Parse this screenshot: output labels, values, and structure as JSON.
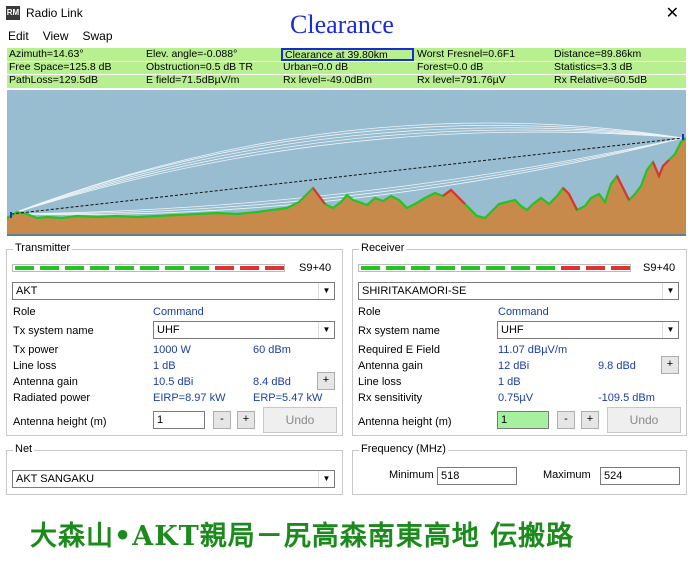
{
  "window": {
    "title": "Radio Link",
    "overlay_title": "Clearance",
    "icon_text": "RM"
  },
  "menu": [
    "Edit",
    "View",
    "Swap"
  ],
  "stats": {
    "row1": [
      "Azimuth=14.63°",
      "Elev. angle=-0.088°",
      "Clearance at 39.80km",
      "Worst Fresnel=0.6F1",
      "Distance=89.86km"
    ],
    "row2": [
      "Free Space=125.8 dB",
      "Obstruction=0.5 dB TR",
      "Urban=0.0 dB",
      "Forest=0.0 dB",
      "Statistics=3.3 dB"
    ],
    "row3": [
      "PathLoss=129.5dB",
      "E field=71.5dBµV/m",
      "Rx level=-49.0dBm",
      "Rx level=791.76µV",
      "Rx Relative=60.5dB"
    ]
  },
  "colors": {
    "accent": "#1a2bd8",
    "stats_bg": "#b8f090",
    "sky": "#98bcd0",
    "terrain": "#c88a4a",
    "banner": "#1d8a1d",
    "meter_green": "#22c422",
    "meter_red": "#e03030"
  },
  "transmitter": {
    "caption": "Transmitter",
    "signal": "S9+40",
    "station": "AKT",
    "role_label": "Role",
    "role_value": "Command",
    "system_label": "Tx system name",
    "system_value": "UHF",
    "power_label": "Tx power",
    "power_w": "1000 W",
    "power_dbm": "60 dBm",
    "line_loss_label": "Line loss",
    "line_loss": "1 dB",
    "gain_label": "Antenna gain",
    "gain_dbi": "10.5 dBi",
    "gain_dbd": "8.4 dBd",
    "radiated_label": "Radiated power",
    "eirp": "EIRP=8.97 kW",
    "erp": "ERP=5.47 kW",
    "height_label": "Antenna height (m)",
    "height_value": "1",
    "undo": "Undo",
    "minus": "-",
    "plus": "+"
  },
  "receiver": {
    "caption": "Receiver",
    "signal": "S9+40",
    "station": "SHIRITAKAMORI-SE",
    "role_label": "Role",
    "role_value": "Command",
    "system_label": "Rx system name",
    "system_value": "UHF",
    "field_label": "Required E Field",
    "field_value": "11.07 dBµV/m",
    "gain_label": "Antenna gain",
    "gain_dbi": "12 dBi",
    "gain_dbd": "9.8 dBd",
    "line_loss_label": "Line loss",
    "line_loss": "1 dB",
    "sens_label": "Rx sensitivity",
    "sens_uv": "0.75µV",
    "sens_dbm": "-109.5 dBm",
    "height_label": "Antenna height (m)",
    "height_value": "1",
    "undo": "Undo",
    "minus": "-",
    "plus": "+"
  },
  "net": {
    "caption": "Net",
    "value": "AKT SANGAKU"
  },
  "frequency": {
    "caption": "Frequency (MHz)",
    "min_label": "Minimum",
    "min_value": "518",
    "max_label": "Maximum",
    "max_value": "524"
  },
  "banner": "大森山•AKT親局－尻高森南東高地 伝搬路"
}
